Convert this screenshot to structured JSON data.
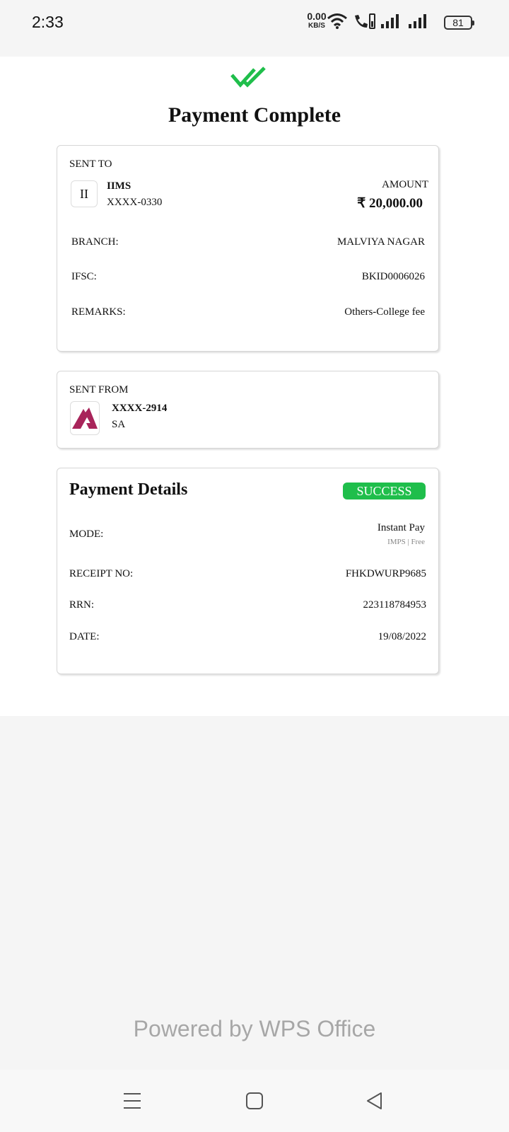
{
  "status_bar": {
    "time": "2:33",
    "net_speed_value": "0.00",
    "net_speed_unit": "KB/S",
    "battery": "81",
    "icons": [
      "wifi-icon",
      "volte-call-icon",
      "signal-icon",
      "signal-icon",
      "battery-icon"
    ]
  },
  "header": {
    "title": "Payment Complete",
    "icon": "double-check-icon",
    "accent_color": "#1fbe4b"
  },
  "sent_to": {
    "heading": "SENT TO",
    "avatar_initials": "II",
    "name": "IIMS",
    "account": "XXXX-0330",
    "amount_label": "AMOUNT",
    "amount": "₹ 20,000.00",
    "rows": [
      {
        "label": "BRANCH:",
        "value": "MALVIYA NAGAR"
      },
      {
        "label": "IFSC:",
        "value": "BKID0006026"
      },
      {
        "label": "REMARKS:",
        "value": "Others-College fee"
      }
    ]
  },
  "sent_from": {
    "heading": "SENT FROM",
    "bank_logo": "axis-bank-logo",
    "logo_color": "#a8245a",
    "account": "XXXX-2914",
    "account_type": "SA"
  },
  "payment_details": {
    "heading": "Payment Details",
    "status": "SUCCESS",
    "status_color": "#1fbe4b",
    "mode_label": "MODE:",
    "mode_value": "Instant Pay",
    "mode_sub": "IMPS | Free",
    "rows": [
      {
        "label": "RECEIPT NO:",
        "value": "FHKDWURP9685"
      },
      {
        "label": "RRN:",
        "value": "223118784953"
      },
      {
        "label": "DATE:",
        "value": "19/08/2022"
      }
    ]
  },
  "footer": {
    "powered_by": "Powered by WPS Office"
  },
  "nav": {
    "buttons": [
      "menu-icon",
      "home-icon",
      "back-icon"
    ]
  }
}
